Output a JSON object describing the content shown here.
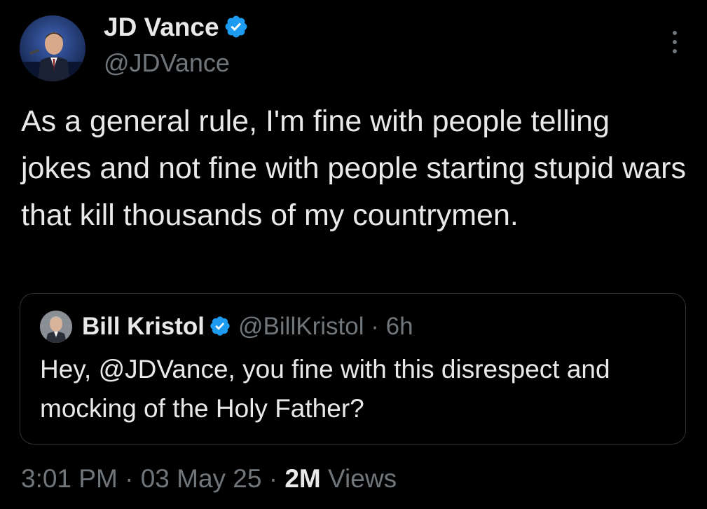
{
  "author": {
    "name": "JD Vance",
    "handle": "@JDVance",
    "verified": true
  },
  "tweet": {
    "text": "As a general rule, I'm fine with people telling jokes and not fine with people starting stupid wars that kill thousands of my countrymen."
  },
  "quoted_tweet": {
    "author_name": "Bill Kristol",
    "handle": "@BillKristol",
    "separator": "·",
    "time": "6h",
    "verified": true,
    "text": "Hey, @JDVance, you fine with this disrespect and mocking of the Holy Father?"
  },
  "meta": {
    "time": "3:01 PM",
    "separator_1": "·",
    "date": "03 May 25",
    "separator_2": "·",
    "views_count": "2M",
    "views_label": "Views"
  },
  "colors": {
    "background": "#000000",
    "text_primary": "#e7e9ea",
    "text_secondary": "#71767b",
    "verified_badge": "#1d9bf0",
    "border": "#2f3336"
  },
  "icons": {
    "verified": "verified-badge-icon",
    "more": "more-options-icon"
  }
}
